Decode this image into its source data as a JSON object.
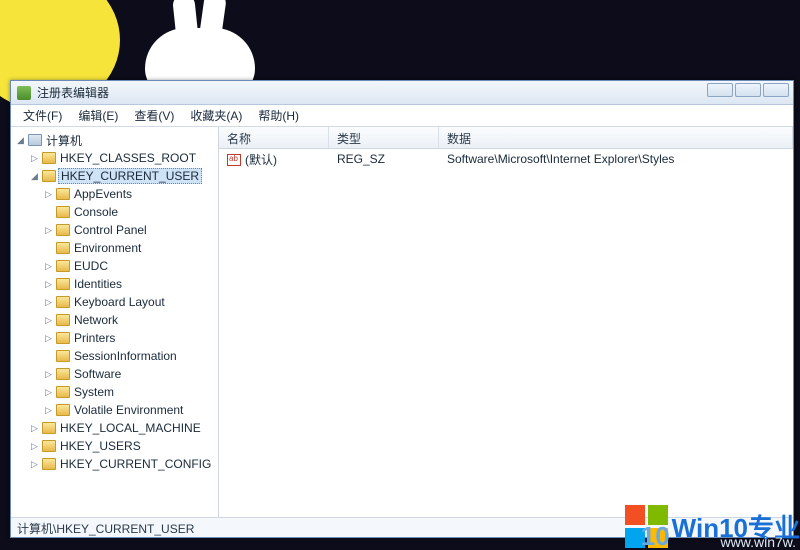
{
  "app": {
    "title": "注册表编辑器"
  },
  "menu": {
    "file": "文件(F)",
    "edit": "编辑(E)",
    "view": "查看(V)",
    "fav": "收藏夹(A)",
    "help": "帮助(H)"
  },
  "tree": {
    "root": "计算机",
    "hkcr": "HKEY_CLASSES_ROOT",
    "hkcu": "HKEY_CURRENT_USER",
    "hklm": "HKEY_LOCAL_MACHINE",
    "hku": "HKEY_USERS",
    "hkcc": "HKEY_CURRENT_CONFIG",
    "sub": {
      "appevents": "AppEvents",
      "console": "Console",
      "controlpanel": "Control Panel",
      "environment": "Environment",
      "eudc": "EUDC",
      "identities": "Identities",
      "keyboard": "Keyboard Layout",
      "network": "Network",
      "printers": "Printers",
      "session": "SessionInformation",
      "software": "Software",
      "system": "System",
      "volatile": "Volatile Environment"
    }
  },
  "columns": {
    "name": "名称",
    "type": "类型",
    "data": "数据"
  },
  "values": [
    {
      "name": "(默认)",
      "type": "REG_SZ",
      "data": "Software\\Microsoft\\Internet Explorer\\Styles"
    }
  ],
  "status": "计算机\\HKEY_CURRENT_USER",
  "watermark": {
    "ten": "10",
    "brand": "Win10专业",
    "url": "www.win7w."
  }
}
